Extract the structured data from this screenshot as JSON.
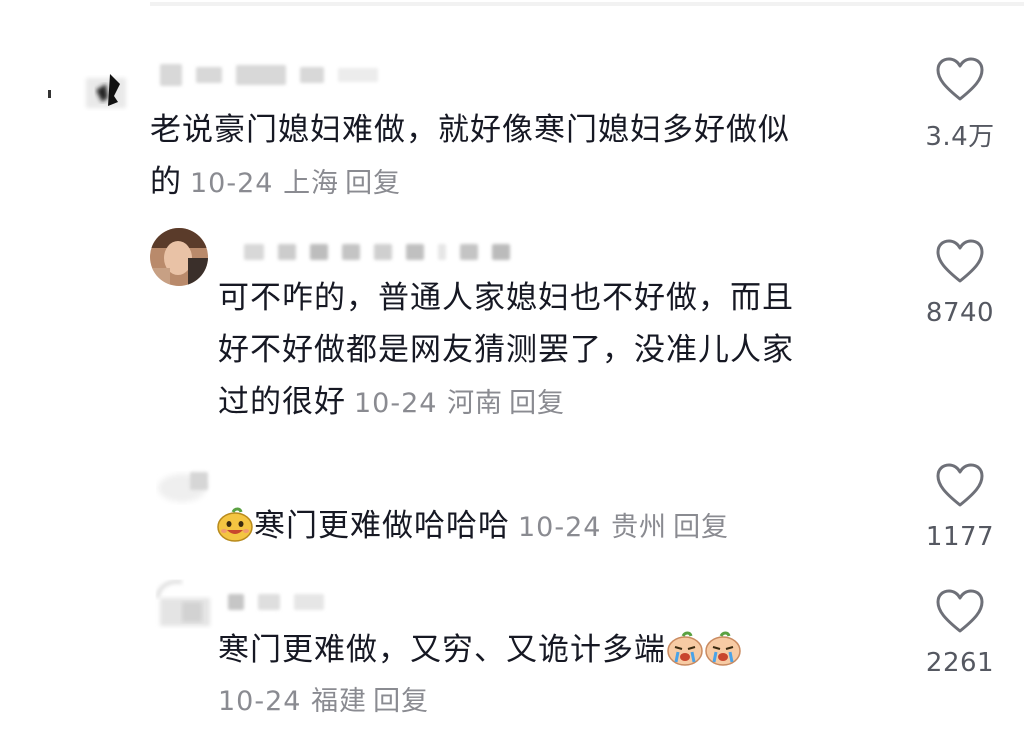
{
  "comments": [
    {
      "text": "老说豪门媳妇难做，就好像寒门媳妇多好做似",
      "text_line2": "的",
      "date": "10-24",
      "location": "上海",
      "reply": "回复",
      "likes": "3.4万"
    },
    {
      "text_line1": "可不咋的，普通人家媳妇也不好做，而且",
      "text_line2": "好不好做都是网友猜测罢了，没准儿人家",
      "text_line3": "过的很好",
      "date": "10-24",
      "location": "河南",
      "reply": "回复",
      "likes": "8740"
    },
    {
      "text": "寒门更难做哈哈哈",
      "date": "10-24",
      "location": "贵州",
      "reply": "回复",
      "likes": "1177",
      "emoji": "grinning-sticker"
    },
    {
      "text": "寒门更难做，又穷、又诡计多端",
      "date": "10-24",
      "location": "福建",
      "reply": "回复",
      "likes": "2261",
      "emoji": "crying-sticker"
    }
  ],
  "icons": {
    "like": "heart-outline-icon"
  },
  "colors": {
    "text": "#161823",
    "meta": "#8a8b91",
    "count": "#555861"
  }
}
